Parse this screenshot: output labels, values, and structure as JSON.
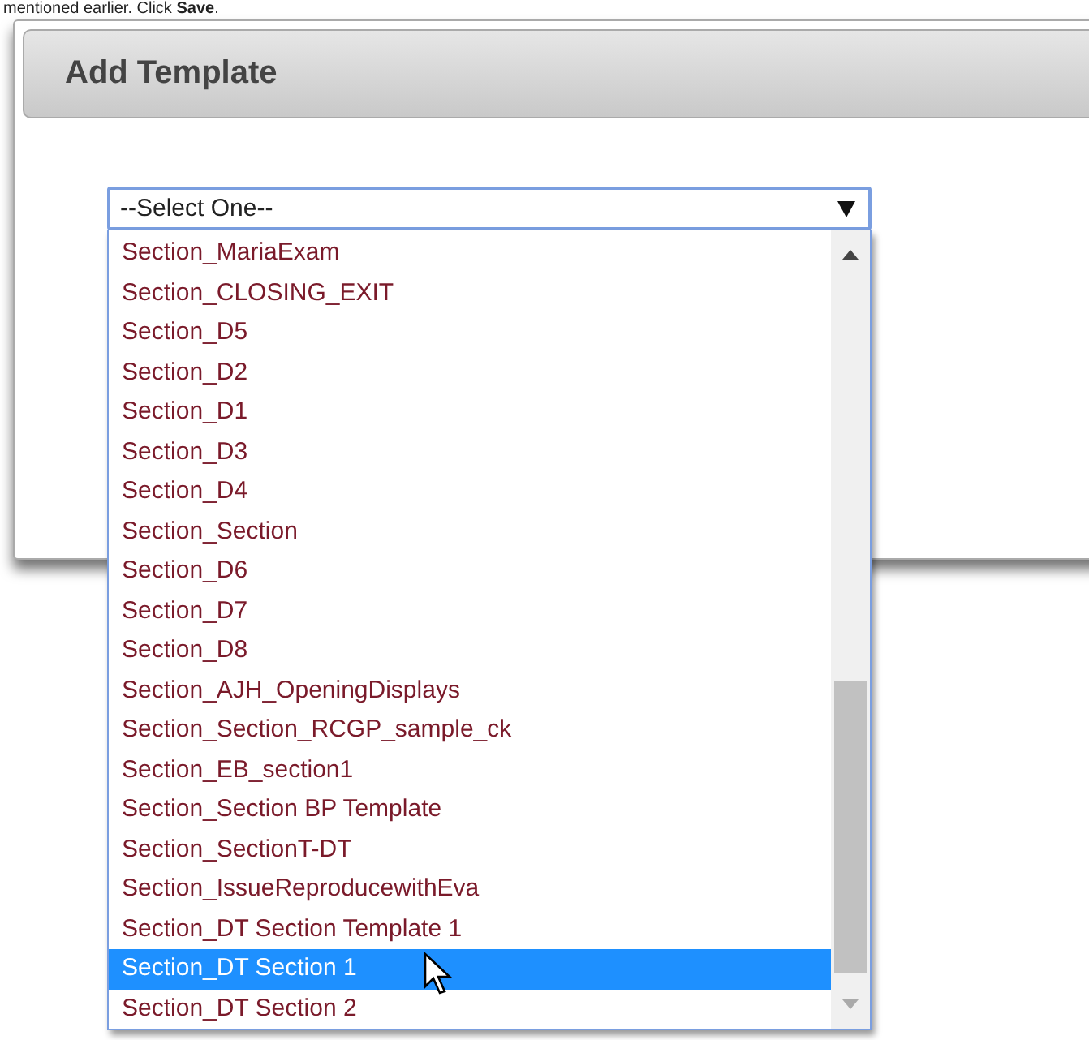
{
  "instruction": "mentioned earlier. Click **Save**.",
  "dialog": {
    "title": "Add Template",
    "select": {
      "value": "--Select One--",
      "expanded": true,
      "options": [
        {
          "label": "Section_MariaExam",
          "selected": false
        },
        {
          "label": "Section_CLOSING_EXIT",
          "selected": false
        },
        {
          "label": "Section_D5",
          "selected": false
        },
        {
          "label": "Section_D2",
          "selected": false
        },
        {
          "label": "Section_D1",
          "selected": false
        },
        {
          "label": "Section_D3",
          "selected": false
        },
        {
          "label": "Section_D4",
          "selected": false
        },
        {
          "label": "Section_Section",
          "selected": false
        },
        {
          "label": "Section_D6",
          "selected": false
        },
        {
          "label": "Section_D7",
          "selected": false
        },
        {
          "label": "Section_D8",
          "selected": false
        },
        {
          "label": "Section_AJH_OpeningDisplays",
          "selected": false
        },
        {
          "label": "Section_Section_RCGP_sample_ck",
          "selected": false
        },
        {
          "label": "Section_EB_section1",
          "selected": false
        },
        {
          "label": "Section_Section BP Template",
          "selected": false
        },
        {
          "label": "Section_SectionT-DT",
          "selected": false
        },
        {
          "label": "Section_IssueReproducewithEva",
          "selected": false
        },
        {
          "label": "Section_DT Section Template 1",
          "selected": false
        },
        {
          "label": "Section_DT Section 1",
          "selected": true
        },
        {
          "label": "Section_DT Section 2",
          "selected": false
        }
      ]
    }
  }
}
